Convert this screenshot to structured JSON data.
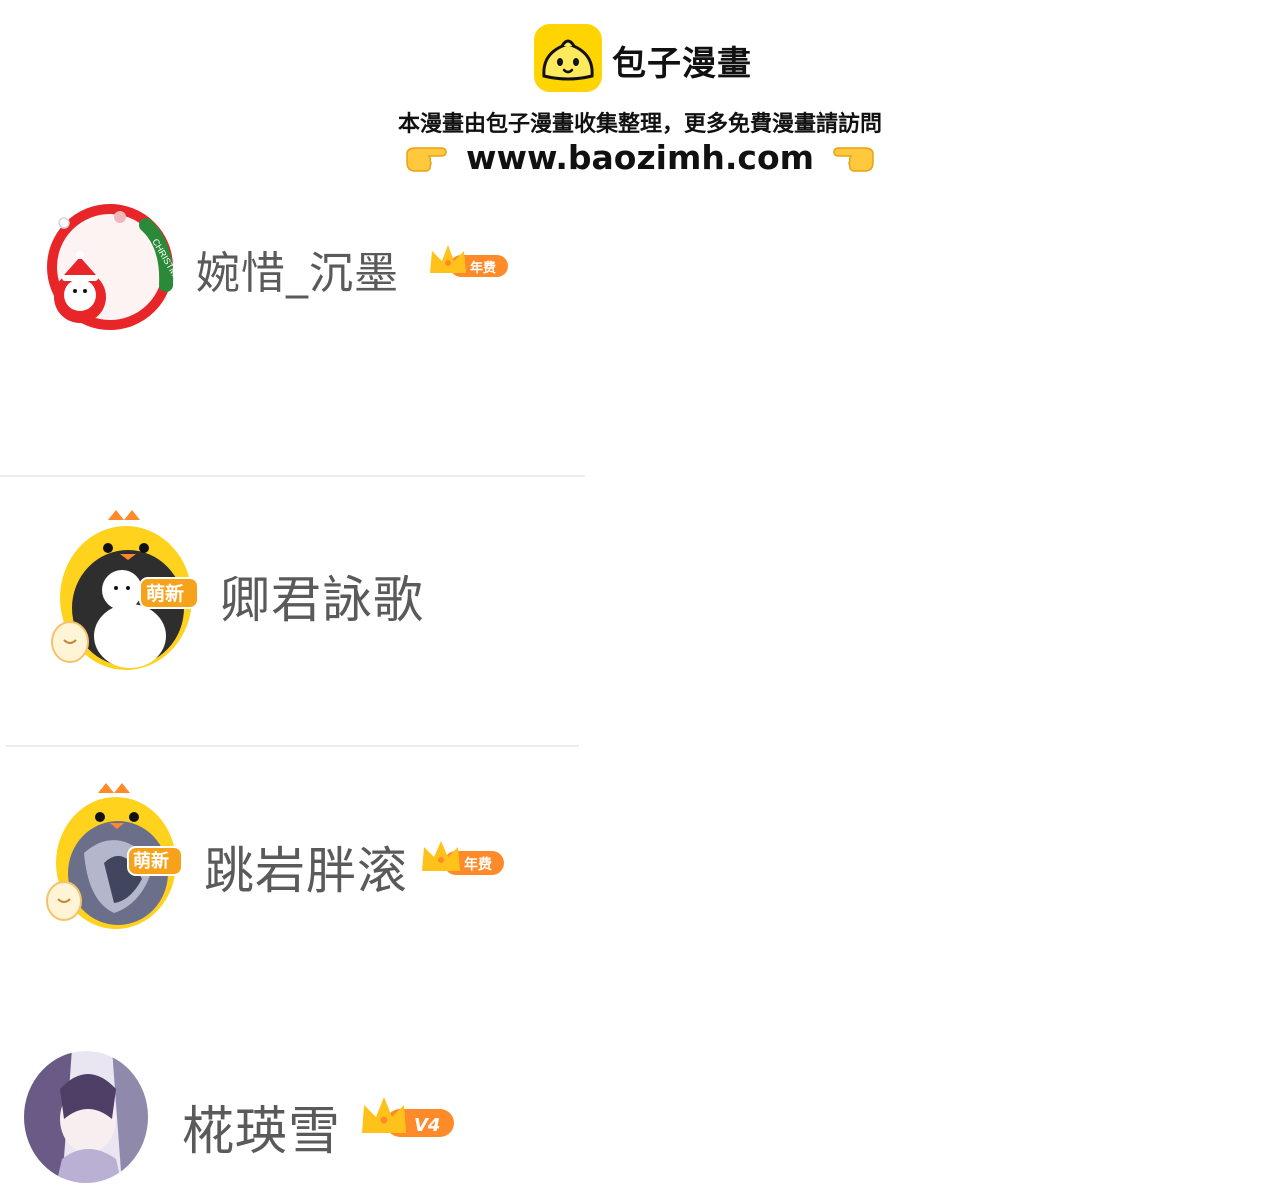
{
  "header": {
    "brand_name": "包子漫畫",
    "note": "本漫畫由包子漫畫收集整理，更多免費漫畫請訪問",
    "url": "www.baozimh.com",
    "logo_icon": "bun-logo-icon",
    "pointer_icons": [
      "pointing-right-hand-icon",
      "pointing-left-hand-icon"
    ],
    "brand_color": "#ffd400"
  },
  "users": [
    {
      "name": "婉惜_沉墨",
      "badge": "年费",
      "avatar_frame": "christmas-wreath"
    },
    {
      "name": "卿君詠歌",
      "badge_new": "萌新",
      "avatar_frame": "yellow-chick"
    },
    {
      "name": "跳岩胖滚",
      "badge": "年费",
      "badge_new": "萌新",
      "avatar_frame": "yellow-chick"
    },
    {
      "name": "椛瑛雪",
      "badge": "V4",
      "avatar_frame": "plain"
    }
  ],
  "colors": {
    "username": "#5a5a5a",
    "crown": "#ffc21a",
    "badge_bg": "#ff8a2a",
    "badge_text": "#ffffff",
    "christmas_red": "#e8262a",
    "christmas_green": "#2a8a3a",
    "chick_yellow": "#ffd21e",
    "divider": "#ececec"
  }
}
